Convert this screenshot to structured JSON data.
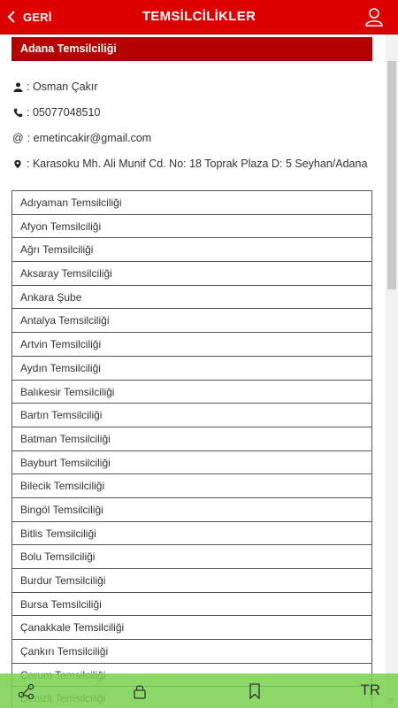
{
  "header": {
    "back_label": "GERİ",
    "title": "TEMSİLCİLİKLER",
    "back_icon": "chevron-left-icon",
    "user_icon": "user-icon"
  },
  "selected": {
    "name": "Adana Temsilciliği",
    "contact_name": ": Osman Çakır",
    "phone": ": 05077048510",
    "email_prefix": "@",
    "email": ": emetincakir@gmail.com",
    "address": ": Karasoku Mh. Ali Munif Cd. No: 18 Toprak Plaza D: 5 Seyhan/Adana"
  },
  "list": [
    "Adıyaman Temsilciliği",
    "Afyon Temsilciliği",
    "Ağrı Temsilciliği",
    "Aksaray Temsilciliği",
    "Ankara Şube",
    "Antalya Temsilciliği",
    "Artvin Temsilciliği",
    "Aydın Temsilciliği",
    "Balıkesir Temsilciliği",
    "Bartın Temsilciliği",
    "Batman Temsilciliği",
    "Bayburt Temsilciliği",
    "Bilecik Temsilciliği",
    "Bingöl Temsilciliği",
    "Bitlis Temsilciliği",
    "Bolu Temsilciliği",
    "Burdur Temsilciliği",
    "Bursa Temsilciliği",
    "Çanakkale Temsilciliği",
    "Çankırı Temsilciliği",
    "Çorum Temsilciliği",
    "Denizli Temsilciliği"
  ],
  "bottom": {
    "share_icon": "share-icon",
    "lock_icon": "lock-icon",
    "bookmark_icon": "bookmark-icon",
    "language": "TR"
  },
  "colors": {
    "header_red": "#dd0000",
    "selected_red": "#b50000",
    "bottom_green": "#78d250"
  }
}
